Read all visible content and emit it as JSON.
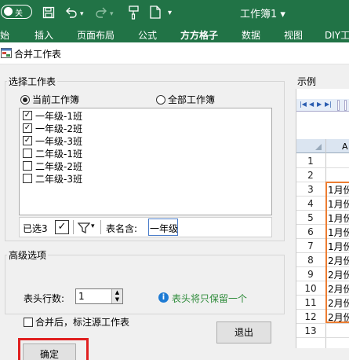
{
  "excel": {
    "autosave_label": "关",
    "workbook_title": "工作簿1 ▾",
    "ribbon_tabs": [
      "开始",
      "插入",
      "页面布局",
      "公式",
      "方方格子",
      "数据",
      "视图",
      "DIY工"
    ]
  },
  "dialog": {
    "title": "合并工作表",
    "select_group_label": "选择工作表",
    "radio_current": "当前工作簿",
    "radio_all": "全部工作簿",
    "sheets": [
      {
        "label": "一年级-1班",
        "checked": true
      },
      {
        "label": "一年级-2班",
        "checked": true
      },
      {
        "label": "一年级-3班",
        "checked": true
      },
      {
        "label": "二年级-1班",
        "checked": false
      },
      {
        "label": "二年级-2班",
        "checked": false
      },
      {
        "label": "二年级-3班",
        "checked": false
      }
    ],
    "selected_count": "已选3",
    "name_contains_label": "表名含:",
    "name_contains_value": "一年级",
    "advanced_group_label": "高级选项",
    "header_rows_label": "表头行数:",
    "header_rows_value": "1",
    "info_text": "表头将只保留一个",
    "mark_source_label": "合并后，标注源工作表",
    "ok_label": "确定",
    "exit_label": "退出",
    "example_label": "示例"
  },
  "preview": {
    "column_header": "A",
    "rows": [
      {
        "num": "1",
        "text": ""
      },
      {
        "num": "2",
        "text": ""
      },
      {
        "num": "3",
        "text": "1月份"
      },
      {
        "num": "4",
        "text": "1月份"
      },
      {
        "num": "5",
        "text": "1月份"
      },
      {
        "num": "6",
        "text": "1月份"
      },
      {
        "num": "7",
        "text": "1月份"
      },
      {
        "num": "8",
        "text": "2月份"
      },
      {
        "num": "9",
        "text": "2月份"
      },
      {
        "num": "10",
        "text": "2月份"
      },
      {
        "num": "11",
        "text": "2月份"
      },
      {
        "num": "12",
        "text": "2月份"
      },
      {
        "num": "13",
        "text": ""
      }
    ]
  },
  "colors": {
    "excel_green": "#217346",
    "highlight_red": "#e02020",
    "preview_orange": "#ed7d31",
    "info_blue": "#1e7bd4",
    "info_text_green": "#2e8b3a"
  }
}
